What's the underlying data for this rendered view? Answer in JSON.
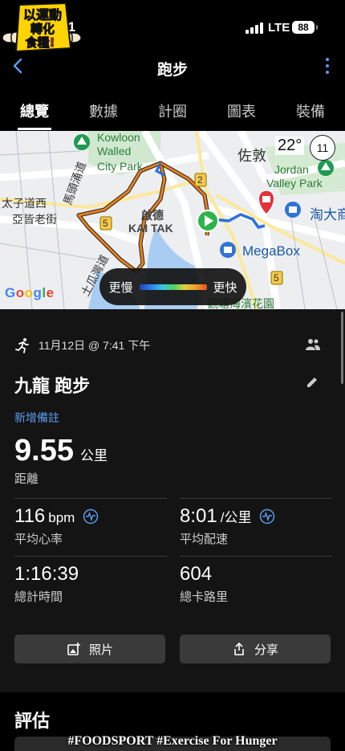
{
  "status_bar": {
    "time": "1:01",
    "network": "LTE",
    "battery": "88"
  },
  "logo": {
    "line1": "以運動",
    "line2": "轉化",
    "line3": "食糧!"
  },
  "header": {
    "title": "跑步"
  },
  "tabs": [
    "總覽",
    "數據",
    "計圈",
    "圖表",
    "裝備"
  ],
  "map": {
    "labels": {
      "kowloon": "Kowloon",
      "walled": "Walled",
      "city_park": "City Park",
      "jordan": "Jordan",
      "valley_park": "Valley Park",
      "zuodun": "佐敦",
      "taizi_dao": "太子道西",
      "yajie": "亞皆老街",
      "matou": "馬頭涌道",
      "qide": "啟德",
      "kai_tak": "KAI TAK",
      "tugua": "土瓜灣道",
      "megabox": "MegaBox",
      "taoda": "淘大商",
      "park_bottom": "觀塘海濱花園",
      "route_2": "2",
      "route_5a": "5",
      "route_5b": "5"
    },
    "temperature": "22°",
    "compass": "11",
    "google": [
      "G",
      "o",
      "o",
      "g",
      "l",
      "e"
    ],
    "slower": "更慢",
    "faster": "更快"
  },
  "activity": {
    "datetime": "11月12日 @ 7:41 下午",
    "name": "九龍 跑步",
    "add_note": "新增備註",
    "distance_value": "9.55",
    "distance_unit": "公里",
    "distance_label": "距離",
    "stats": [
      {
        "value": "116",
        "unit": "bpm",
        "label": "平均心率"
      },
      {
        "value": "8:01",
        "unit": "/公里",
        "label": "平均配速"
      },
      {
        "value": "1:16:39",
        "unit": "",
        "label": "總計時間"
      },
      {
        "value": "604",
        "unit": "",
        "label": "總卡路里"
      }
    ]
  },
  "buttons": {
    "photos": "照片",
    "share": "分享"
  },
  "assessment": {
    "title": "評估"
  },
  "watermark": "#FOODSPORT #Exercise For Hunger",
  "colors": {
    "accent": "#5b9cf0",
    "route": "#e8801c",
    "pace_slow": "#2b6fe0",
    "pace_fast": "#e85020"
  }
}
